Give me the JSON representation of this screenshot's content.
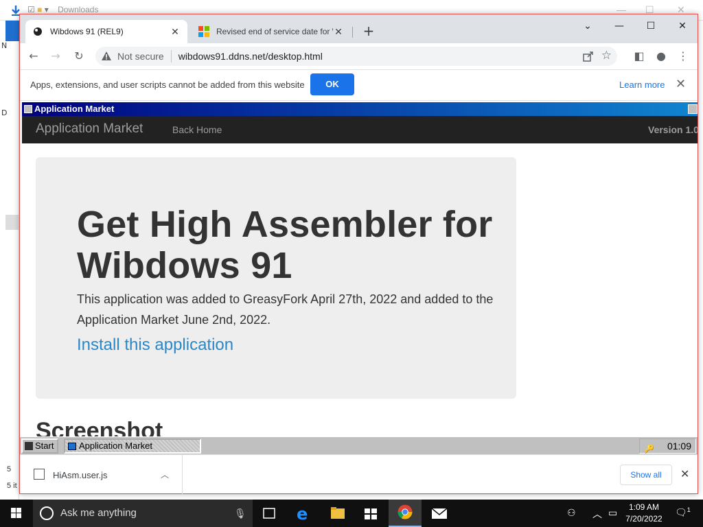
{
  "explorer": {
    "title_text": "Downloads",
    "side_text_1": "5",
    "side_text_2": "5 it",
    "letter_d": "D",
    "letter_n": "N"
  },
  "chrome": {
    "tabs": [
      {
        "title": "Wibdows 91 (REL9)",
        "active": true
      },
      {
        "title": "Revised end of service date for W",
        "active": false
      }
    ],
    "omnibox": {
      "security": "Not secure",
      "url": "wibdows91.ddns.net/desktop.html"
    },
    "infobar": {
      "message": "Apps, extensions, and user scripts cannot be added from this website",
      "ok": "OK",
      "learn_more": "Learn more"
    },
    "downloads": {
      "file": "HiAsm.user.js",
      "show_all": "Show all"
    }
  },
  "win91": {
    "window_title": "Application Market",
    "navbar": {
      "brand": "Application Market",
      "back_home": "Back Home",
      "version": "Version 1.0"
    },
    "heading": "Get High Assembler for Wibdows 91",
    "description": "This application was added to GreasyFork April 27th, 2022 and added to the Application Market June 2nd, 2022.",
    "install": "Install this application",
    "screenshot_heading": "Screenshot",
    "taskbar": {
      "start": "Start",
      "task": "Application Market",
      "clock": "01:09"
    }
  },
  "taskbar": {
    "search_placeholder": "Ask me anything",
    "time": "1:09 AM",
    "date": "7/20/2022",
    "notif_count": "1"
  },
  "colors": {
    "chrome_blue": "#1a73e8",
    "win91_title": "#000080",
    "navbar_bg": "#222222",
    "install_link": "#2a87c8"
  }
}
